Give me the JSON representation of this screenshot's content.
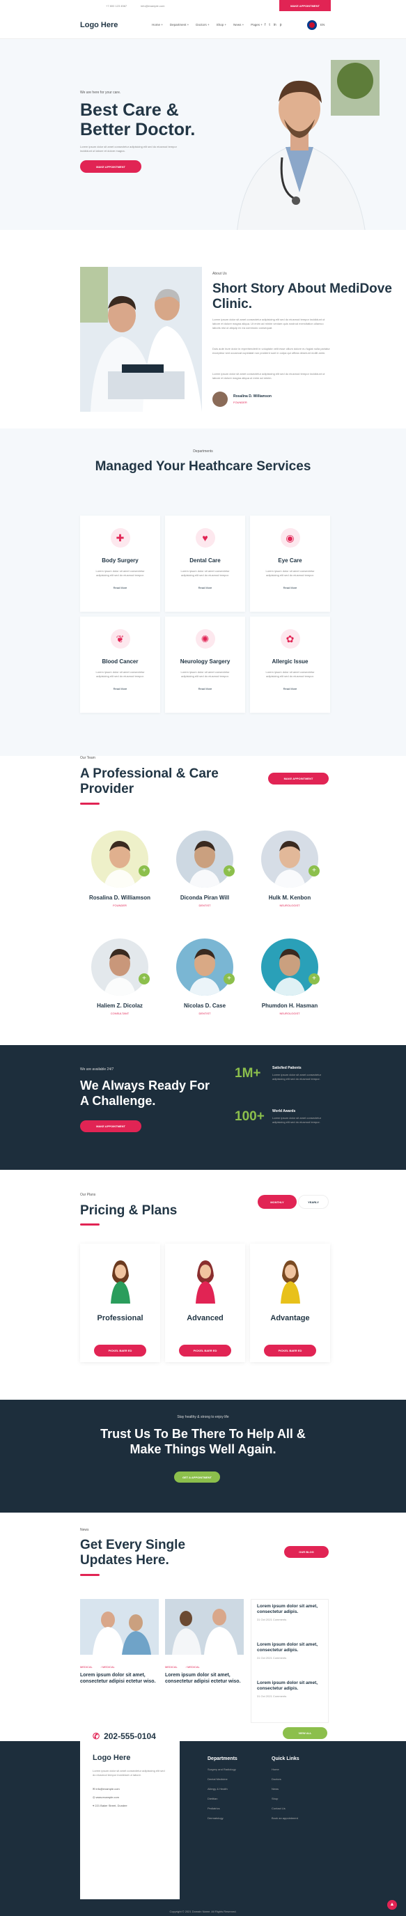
{
  "topbar": {
    "phone": "+7 800 123 4567",
    "email": "info@example.com",
    "appointment": "MAKE APPOINTMENT"
  },
  "nav": {
    "logo": "Logo Here",
    "menu": [
      "Home +",
      "Department +",
      "Doctors +",
      "Shop +",
      "News +",
      "Pages +"
    ],
    "socials": [
      "f",
      "t",
      "in",
      "p"
    ],
    "lang": "EN"
  },
  "hero": {
    "eyebrow": "We are here for your care.",
    "title": "Best Care & Better Doctor.",
    "desc": "Lorem ipsum dolor sit amet consectetur adipisicing elit sed do eiusmod tempor incididunt ut labore et dolore magna.",
    "button": "MAKE APPOINTMENT"
  },
  "story": {
    "eyebrow": "About Us",
    "title": "Short Story About MediDove Clinic.",
    "p1": "Lorem ipsum dolor sit amet consectetur adipisicing elit sed do eiusmod tempor incididunt ut labore et dolore magna aliqua. Ut enim ad minim veniam quis nostrud exercitation ullamco laboris nisi ut aliquip ex ea commodo consequat.",
    "p2": "Duis aute irure dolor in reprehenderit in voluptate velit esse cillum dolore eu fugiat nulla pariatur excepteur sint occaecat cupidatat non proident sunt in culpa qui officia deserunt mollit anim.",
    "p3": "Lorem ipsum dolor sit amet consectetur adipisicing elit sed do eiusmod tempor incididunt ut labore et dolore magna aliqua ut enim ad minim.",
    "name": "Rosalina D. Williamson",
    "role": "FOUNDER"
  },
  "services": {
    "eyebrow": "Departments",
    "title": "Managed Your Heathcare Services",
    "cards": [
      {
        "title": "Body Surgery",
        "icon": "surgery-icon",
        "glyph": "✚",
        "desc": "Lorem ipsum dolor sit amet consectetur adipisicing elit sed do eiusmod tempor.",
        "link": "Read More"
      },
      {
        "title": "Dental Care",
        "icon": "tooth-icon",
        "glyph": "♥",
        "desc": "Lorem ipsum dolor sit amet consectetur adipisicing elit sed do eiusmod tempor.",
        "link": "Read More"
      },
      {
        "title": "Eye Care",
        "icon": "eye-icon",
        "glyph": "◉",
        "desc": "Lorem ipsum dolor sit amet consectetur adipisicing elit sed do eiusmod tempor.",
        "link": "Read More"
      },
      {
        "title": "Blood Cancer",
        "icon": "ribbon-icon",
        "glyph": "❦",
        "desc": "Lorem ipsum dolor sit amet consectetur adipisicing elit sed do eiusmod tempor.",
        "link": "Read More"
      },
      {
        "title": "Neurology Sargery",
        "icon": "brain-icon",
        "glyph": "✺",
        "desc": "Lorem ipsum dolor sit amet consectetur adipisicing elit sed do eiusmod tempor.",
        "link": "Read More"
      },
      {
        "title": "Allergic Issue",
        "icon": "allergy-icon",
        "glyph": "✿",
        "desc": "Lorem ipsum dolor sit amet consectetur adipisicing elit sed do eiusmod tempor.",
        "link": "Read More"
      }
    ]
  },
  "team": {
    "eyebrow": "Our Team",
    "title": "A Professional & Care Provider",
    "button": "MAKE APPOINTMENT",
    "members": [
      {
        "name": "Rosalina D. Williamson",
        "role": "FOUNDER",
        "bg": "#eef0c9",
        "skin": "#e0b08e"
      },
      {
        "name": "Diconda Piran Will",
        "role": "DENTIST",
        "bg": "#cdd8e2",
        "skin": "#caa07f"
      },
      {
        "name": "Hulk M. Kenbon",
        "role": "NEUROLOGIST",
        "bg": "#d6dde6",
        "skin": "#e2b899"
      },
      {
        "name": "Haliem Z. Dicolaz",
        "role": "CONSULTANT",
        "bg": "#e3e8ec",
        "skin": "#c9977a"
      },
      {
        "name": "Nicolas D. Case",
        "role": "DENTIST",
        "bg": "#7ab6d3",
        "skin": "#d9a985"
      },
      {
        "name": "Phumdon H. Hasman",
        "role": "NEUROLOGIST",
        "bg": "#2aa0b8",
        "skin": "#caa07f"
      }
    ]
  },
  "challenge": {
    "eyebrow": "We are available 24/7",
    "title": "We Always Ready For A Challenge.",
    "button": "MAKE APPOINTMENT",
    "stats": [
      {
        "value": "1M+",
        "label": "Satisfied Patients",
        "desc": "Lorem ipsum dolor sit amet consectetur adipisicing elit sed do eiusmod tempor."
      },
      {
        "value": "100+",
        "label": "World Awards",
        "desc": "Lorem ipsum dolor sit amet consectetur adipisicing elit sed do eiusmod tempor."
      }
    ]
  },
  "pricing": {
    "eyebrow": "Our Plans",
    "title": "Pricing & Plans",
    "monthly": "MONTHLY",
    "yearly": "YEARLY",
    "plans": [
      {
        "title": "Professional",
        "button": "PICKEL BAER ED",
        "shirt": "#2a9d5c",
        "hair": "#6b3a1f"
      },
      {
        "title": "Advanced",
        "button": "PICKEL BAER ED",
        "shirt": "#e12454",
        "hair": "#8a2e2e"
      },
      {
        "title": "Advantage",
        "button": "PICKEL BAER ED",
        "shirt": "#e8c11a",
        "hair": "#7a4a22"
      }
    ]
  },
  "cta": {
    "eyebrow": "Stay healthy & strong to enjoy life",
    "title": "Trust Us To Be There To Help All & Make Things Well Again.",
    "button": "GET A APPOINTMENT"
  },
  "blog": {
    "eyebrow": "News",
    "title": "Get Every Single Updates Here.",
    "button": "OUR BLOG",
    "posts": [
      {
        "tag": "MEDICAL",
        "tag2": "/ MEDICAL",
        "title": "Lorem ipsum dolor sit amet, consectetur adipisi ectetur wiso."
      },
      {
        "tag": "MEDICAL",
        "tag2": "/ MEDICAL",
        "title": "Lorem ipsum dolor sit amet, consectetur adipisi ectetur wiso."
      }
    ],
    "side": [
      {
        "title": "Lorem ipsum dolor sit amet, consectetur adipis.",
        "date": "31 Oct 2021   Comments"
      },
      {
        "title": "Lorem ipsum dolor sit amet, consectetur adipis.",
        "date": "31 Oct 2021   Comments"
      },
      {
        "title": "Lorem ipsum dolor sit amet, consectetur adipis.",
        "date": "31 Oct 2021   Comments"
      }
    ],
    "more": "VIEW ALL"
  },
  "footer": {
    "phone": "202-555-0104",
    "logo": "Logo Here",
    "desc": "Lorem ipsum dolor sit amet consectetur adipisicing elit sed do eiusmod tempor incididunt ut labore.",
    "email": "info@example.com",
    "web": "www.example.com",
    "address": "221 Baker Street, Dundee",
    "departments": {
      "title": "Departments",
      "links": [
        "Surgery and Radiology",
        "Dental Medicine",
        "Allergy & Health",
        "Dietitian",
        "Pediatrics",
        "Dermatology"
      ]
    },
    "quick": {
      "title": "Quick Links",
      "links": [
        "Home",
        "Doctors",
        "News",
        "Shop",
        "Contact Us",
        "Book an appointment"
      ]
    },
    "copyright": "Copyright © 2021 Domain Name. All Rights Reserved."
  },
  "colors": {
    "accent": "#e12454",
    "green": "#8cbf4c",
    "dark": "#1d2e3c"
  }
}
